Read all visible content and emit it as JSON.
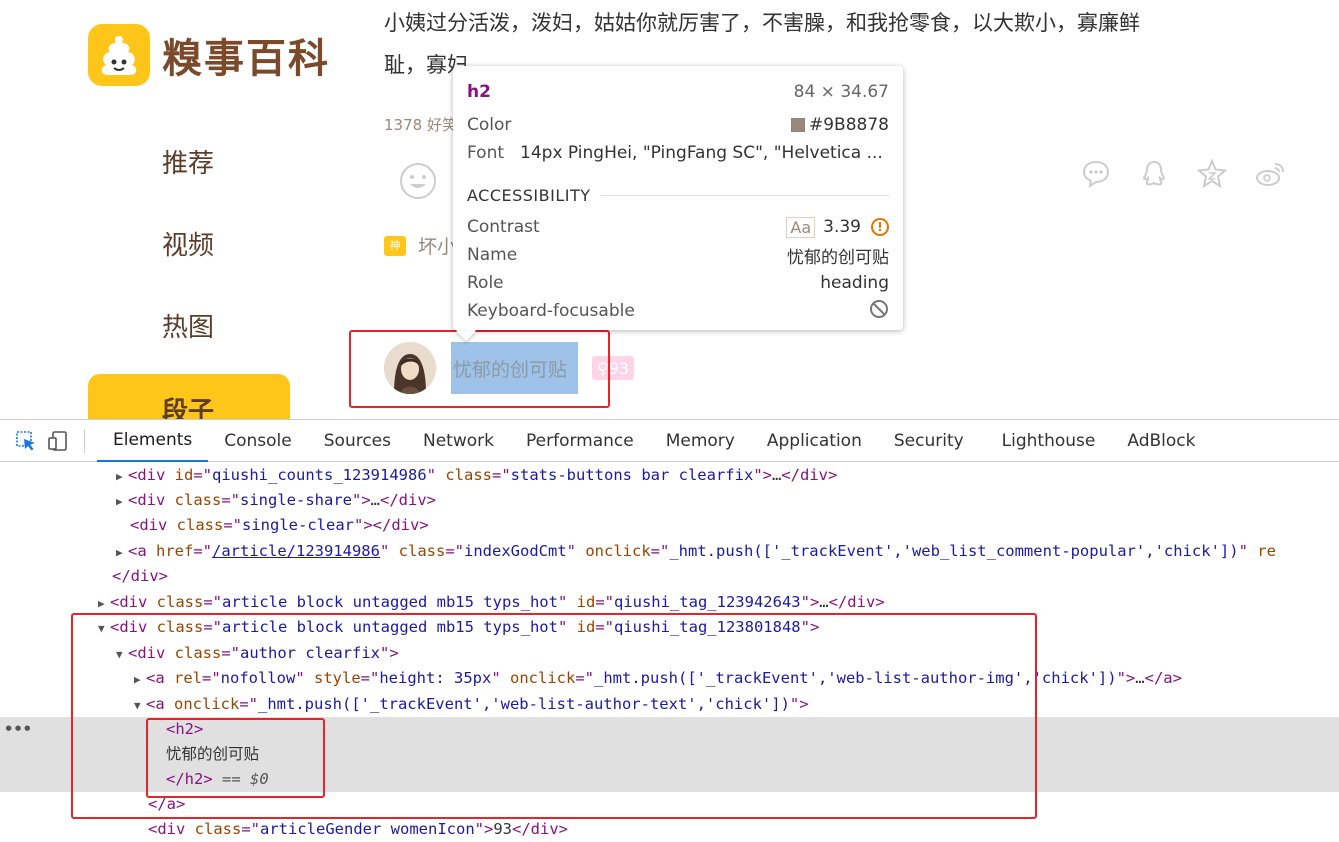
{
  "site": {
    "logo_text": "糗事百科",
    "nav": [
      {
        "label": "推荐"
      },
      {
        "label": "视频"
      },
      {
        "label": "热图"
      },
      {
        "label": "段子"
      }
    ],
    "content_line1": "小姨过分活泼，泼妇，姑姑你就厉害了，不害臊，和我抢零食，以大欺小，寡廉鲜",
    "content_line2": "耻，寡妇……",
    "stats": "1378 好笑",
    "god_cmt_badge": "神",
    "god_cmt_text": "坏小",
    "author_name": "忧郁的创可贴",
    "gender_age": "93"
  },
  "tooltip": {
    "tag": "h2",
    "dimensions": "84 × 34.67",
    "color_label": "Color",
    "color_value": "#9B8878",
    "font_label": "Font",
    "font_value": "14px PingHei, \"PingFang SC\", \"Helvetica ...",
    "accessibility_heading": "ACCESSIBILITY",
    "contrast_label": "Contrast",
    "contrast_aa": "Aa",
    "contrast_value": "3.39",
    "name_label": "Name",
    "name_value": "忧郁的创可贴",
    "role_label": "Role",
    "role_value": "heading",
    "kb_label": "Keyboard-focusable"
  },
  "devtools": {
    "tabs": [
      "Elements",
      "Console",
      "Sources",
      "Network",
      "Performance",
      "Memory",
      "Application",
      "Security",
      "Lighthouse",
      "AdBlock"
    ],
    "active_tab": "Elements",
    "dom": {
      "l1_id": "qiushi_counts_123914986",
      "l1_class": "stats-buttons bar clearfix",
      "l2_class": "single-share",
      "l3_class": "single-clear",
      "l4_href": "/article/123914986",
      "l4_class": "indexGodCmt",
      "l4_onclick": "_hmt.push(['_trackEvent','web_list_comment-popular','chick'])",
      "l6_class": "article block untagged mb15 typs_hot",
      "l6_id": "qiushi_tag_123942643",
      "l7_class": "article block untagged mb15 typs_hot",
      "l7_id": "qiushi_tag_123801848",
      "l8_class": "author clearfix",
      "l9_rel": "nofollow",
      "l9_style": "height: 35px",
      "l9_onclick": "_hmt.push(['_trackEvent','web-list-author-img','chick'])",
      "l10_onclick": "_hmt.push(['_trackEvent','web-list-author-text','chick'])",
      "h2_text": "忧郁的创可贴",
      "sel_marker": "== $0",
      "l15_class": "articleGender womenIcon",
      "l15_text": "93"
    }
  }
}
